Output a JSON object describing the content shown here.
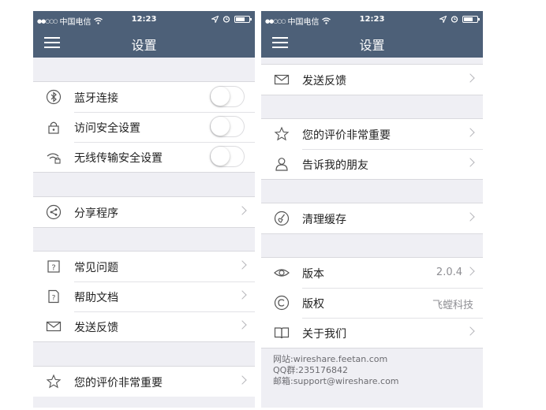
{
  "statusbar": {
    "carrier": "中国电信",
    "time": "12:23"
  },
  "nav": {
    "title": "设置"
  },
  "left_screen": {
    "toggles": [
      {
        "label": "蓝牙连接",
        "icon": "bluetooth-icon",
        "on": false
      },
      {
        "label": "访问安全设置",
        "icon": "lock-icon",
        "on": false
      },
      {
        "label": "无线传输安全设置",
        "icon": "wifi-lock-icon",
        "on": false
      }
    ],
    "share": {
      "label": "分享程序",
      "icon": "share-icon"
    },
    "help": [
      {
        "label": "常见问题",
        "icon": "question-icon"
      },
      {
        "label": "帮助文档",
        "icon": "help-doc-icon"
      },
      {
        "label": "发送反馈",
        "icon": "mail-icon"
      }
    ],
    "rate": {
      "label": "您的评价非常重要",
      "icon": "star-icon"
    }
  },
  "right_screen": {
    "feedback": {
      "label": "发送反馈",
      "icon": "mail-icon"
    },
    "social": [
      {
        "label": "您的评价非常重要",
        "icon": "star-icon"
      },
      {
        "label": "告诉我的朋友",
        "icon": "person-icon"
      }
    ],
    "cache": {
      "label": "清理缓存",
      "icon": "broom-icon"
    },
    "about": [
      {
        "label": "版本",
        "value": "2.0.4",
        "icon": "eye-icon"
      },
      {
        "label": "版权",
        "value": "飞螳科技",
        "icon": "copyright-icon"
      },
      {
        "label": "关于我们",
        "icon": "book-icon"
      }
    ],
    "footer": {
      "website": "网站:wireshare.feetan.com",
      "qq": "QQ群:235176842",
      "email": "邮箱:support@wireshare.com"
    }
  },
  "colors": {
    "navbar": "#4d6078",
    "background": "#efeff4",
    "accent_text": "#222222"
  }
}
